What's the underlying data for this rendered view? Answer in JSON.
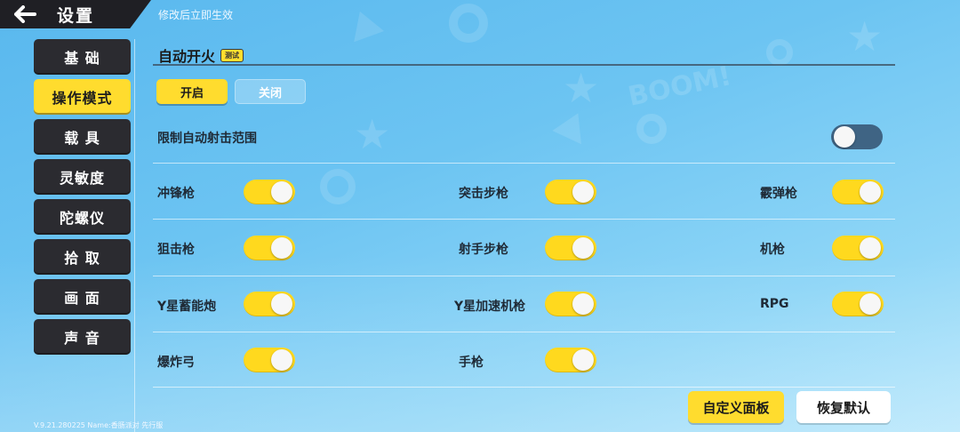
{
  "header": {
    "title": "设置",
    "hint": "修改后立即生效"
  },
  "sidebar": {
    "items": [
      {
        "label": "基 础",
        "active": false
      },
      {
        "label": "操作模式",
        "active": true
      },
      {
        "label": "载 具",
        "active": false
      },
      {
        "label": "灵敏度",
        "active": false
      },
      {
        "label": "陀螺仪",
        "active": false
      },
      {
        "label": "拾 取",
        "active": false
      },
      {
        "label": "画 面",
        "active": false
      },
      {
        "label": "声 音",
        "active": false
      }
    ]
  },
  "section": {
    "title": "自动开火",
    "badge": "测试",
    "segment": {
      "on_label": "开启",
      "off_label": "关闭",
      "selected": "开启"
    },
    "limit_range": {
      "label": "限制自动射击范围",
      "enabled": false
    }
  },
  "weapons": [
    {
      "label": "冲锋枪",
      "enabled": true
    },
    {
      "label": "突击步枪",
      "enabled": true
    },
    {
      "label": "霰弹枪",
      "enabled": true
    },
    {
      "label": "狙击枪",
      "enabled": true
    },
    {
      "label": "射手步枪",
      "enabled": true
    },
    {
      "label": "机枪",
      "enabled": true
    },
    {
      "label": "Y星蓄能炮",
      "enabled": true
    },
    {
      "label": "Y星加速机枪",
      "enabled": true
    },
    {
      "label": "RPG",
      "enabled": true
    },
    {
      "label": "爆炸弓",
      "enabled": true
    },
    {
      "label": "手枪",
      "enabled": true
    }
  ],
  "buttons": {
    "custom_panel": "自定义面板",
    "restore_default": "恢复默认"
  },
  "footer": {
    "version": "V.9.21.280225 Name:香肠派对 先行服"
  },
  "colors": {
    "accent_yellow": "#ffdc2e",
    "sidebar_dark": "#2b2b30",
    "toggle_off": "#3f6484"
  }
}
